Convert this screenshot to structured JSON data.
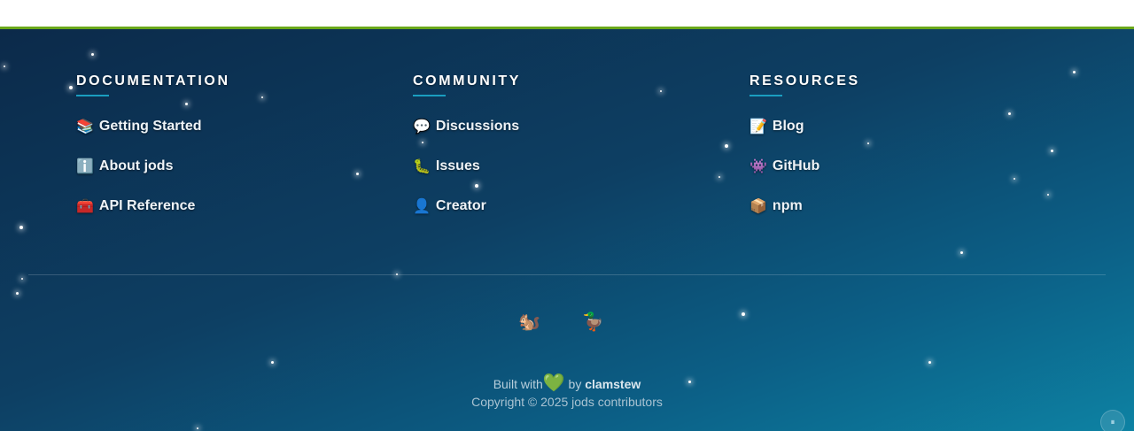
{
  "columns": [
    {
      "title": "DOCUMENTATION",
      "links": [
        {
          "icon": "📚",
          "label": "Getting Started"
        },
        {
          "icon": "ℹ️",
          "label": "About jods"
        },
        {
          "icon": "🧰",
          "label": "API Reference"
        }
      ]
    },
    {
      "title": "COMMUNITY",
      "links": [
        {
          "icon": "💬",
          "label": "Discussions"
        },
        {
          "icon": "🐛",
          "label": "Issues"
        },
        {
          "icon": "👤",
          "label": "Creator"
        }
      ]
    },
    {
      "title": "RESOURCES",
      "links": [
        {
          "icon": "📝",
          "label": "Blog"
        },
        {
          "icon": "👾",
          "label": "GitHub"
        },
        {
          "icon": "📦",
          "label": "npm"
        }
      ]
    }
  ],
  "mascots": {
    "squirrel": "🐿️",
    "duck": "🦆"
  },
  "built": {
    "prefix": "Built with",
    "heart": "💚",
    "by": "by",
    "author": "clamstew"
  },
  "copyright": "Copyright © 2025 jods contributors",
  "pause_label": "⏸",
  "colors": {
    "accent_bar": "#6aa81a",
    "underline": "#1a9ec0"
  }
}
